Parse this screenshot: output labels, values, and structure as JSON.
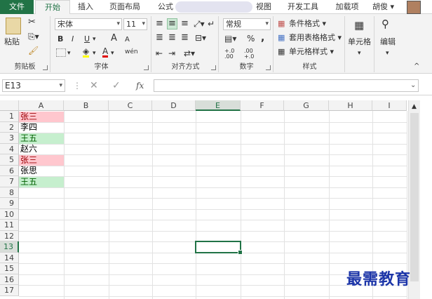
{
  "tabs": [
    {
      "label": "文件",
      "id": "file"
    },
    {
      "label": "开始",
      "id": "home"
    },
    {
      "label": "插入",
      "id": "insert"
    },
    {
      "label": "页面布局",
      "id": "layout"
    },
    {
      "label": "公式",
      "id": "formulas"
    },
    {
      "label": "视图",
      "id": "view"
    },
    {
      "label": "开发工具",
      "id": "developer"
    },
    {
      "label": "加载项",
      "id": "addins"
    }
  ],
  "user": {
    "name": "胡俊 ▾"
  },
  "ribbon": {
    "clipboard": {
      "label": "剪贴板",
      "paste": "粘贴"
    },
    "font": {
      "label": "字体",
      "name": "宋体",
      "size": "11",
      "bold": "B",
      "italic": "I",
      "underline": "U",
      "grow": "A",
      "shrink": "A",
      "phonetic": "wén"
    },
    "alignment": {
      "label": "对齐方式"
    },
    "number": {
      "label": "数字",
      "format": "常规",
      "percent": "%",
      "comma": ",",
      "inc_decimal": "+.0 .00",
      "dec_decimal": ".00 +.0"
    },
    "styles": {
      "label": "样式",
      "conditional": "条件格式 ▾",
      "table": "套用表格格式 ▾",
      "cell": "单元格样式 ▾"
    },
    "cells": {
      "label": "单元格"
    },
    "editing": {
      "label": "编辑"
    }
  },
  "formula_bar": {
    "cell_ref": "E13",
    "fx": "fx",
    "value": ""
  },
  "columns": [
    "A",
    "B",
    "C",
    "D",
    "E",
    "F",
    "G",
    "H",
    "I"
  ],
  "rows": [
    "1",
    "2",
    "3",
    "4",
    "5",
    "6",
    "7",
    "8",
    "9",
    "10",
    "11",
    "12",
    "13",
    "14",
    "15",
    "16",
    "17"
  ],
  "cells": [
    {
      "row": 1,
      "text": "张三",
      "bg": "#ffc7ce"
    },
    {
      "row": 2,
      "text": "李四",
      "bg": ""
    },
    {
      "row": 3,
      "text": "王五",
      "bg": "#c6efce"
    },
    {
      "row": 4,
      "text": "赵六",
      "bg": ""
    },
    {
      "row": 5,
      "text": "张三",
      "bg": "#ffc7ce"
    },
    {
      "row": 6,
      "text": "张思",
      "bg": ""
    },
    {
      "row": 7,
      "text": "王五",
      "bg": "#c6efce"
    }
  ],
  "selected": {
    "col": "E",
    "row": 13
  },
  "watermark": "最需教育",
  "colors": {
    "accent": "#217346",
    "dup_red": "#ffc7ce",
    "dup_green": "#c6efce",
    "watermark": "#1c35a8"
  }
}
